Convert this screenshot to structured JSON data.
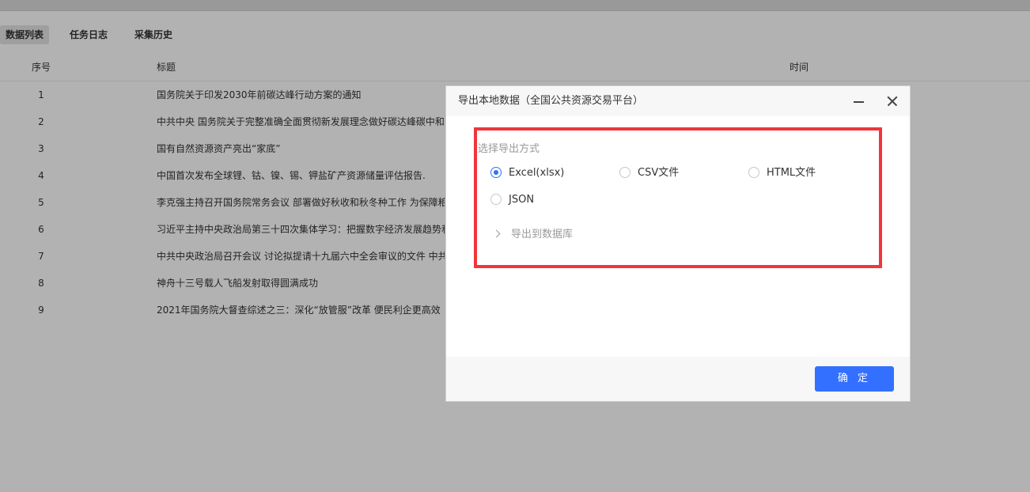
{
  "tabs": [
    {
      "label": "数据列表",
      "active": true
    },
    {
      "label": "任务日志",
      "active": false
    },
    {
      "label": "采集历史",
      "active": false
    }
  ],
  "table": {
    "columns": [
      "序号",
      "标题",
      "时间"
    ],
    "rows": [
      {
        "idx": "1",
        "title": "国务院关于印发2030年前碳达峰行动方案的通知"
      },
      {
        "idx": "2",
        "title": "中共中央 国务院关于完整准确全面贯彻新发展理念做好碳达峰碳中和"
      },
      {
        "idx": "3",
        "title": "国有自然资源资产亮出“家底”"
      },
      {
        "idx": "4",
        "title": "中国首次发布全球锂、钴、镍、锡、钾盐矿产资源储量评估报告."
      },
      {
        "idx": "5",
        "title": "李克强主持召开国务院常务会议 部署做好秋收和秋冬种工作 为保障粮"
      },
      {
        "idx": "6",
        "title": "习近平主持中央政治局第三十四次集体学习：把握数字经济发展趋势和"
      },
      {
        "idx": "7",
        "title": "中共中央政治局召开会议 讨论拟提请十九届六中全会审议的文件 中共"
      },
      {
        "idx": "8",
        "title": "神舟十三号载人飞船发射取得圆满成功"
      },
      {
        "idx": "9",
        "title": "2021年国务院大督查综述之三：深化“放管服”改革 便民利企更高效"
      }
    ]
  },
  "dialog": {
    "title": "导出本地数据（全国公共资源交易平台）",
    "section_label": "选择导出方式",
    "options": [
      {
        "label": "Excel(xlsx)",
        "checked": true
      },
      {
        "label": "CSV文件",
        "checked": false
      },
      {
        "label": "HTML文件",
        "checked": false
      },
      {
        "label": "JSON",
        "checked": false
      }
    ],
    "db_export_label": "导出到数据库",
    "confirm_label": "确 定"
  },
  "colors": {
    "accent": "#3370ff",
    "highlight_border": "#f0353c",
    "overlay": "rgba(0,0,0,0.30)"
  },
  "icons": {
    "minimize": "minimize-icon",
    "close": "close-icon",
    "expand": "chevron-right-icon"
  }
}
